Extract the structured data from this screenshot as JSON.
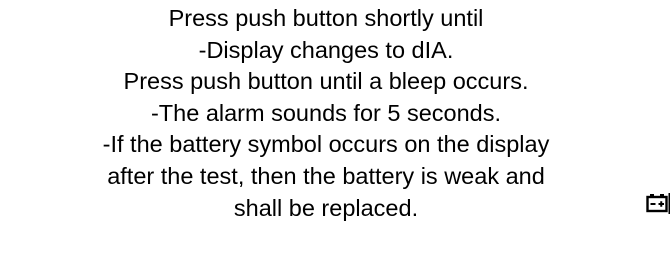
{
  "instructions": {
    "lines": [
      "Press push button shortly until",
      "-Display changes to dIA.",
      "Press push button until a bleep occurs.",
      "-The alarm sounds for 5 seconds.",
      "-If the battery symbol occurs on the display",
      "after the test, then the battery is weak and",
      "shall be replaced."
    ]
  },
  "icons": {
    "battery": "battery-icon"
  }
}
